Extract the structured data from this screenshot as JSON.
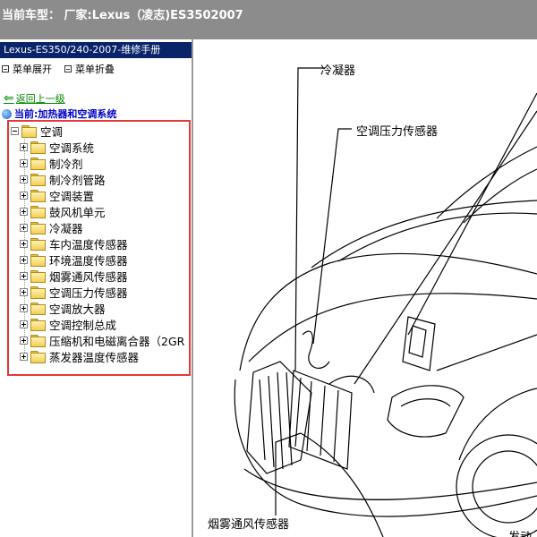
{
  "titlebar": {
    "text": "当前车型： 厂家:Lexus（凌志)ES3502007"
  },
  "sidebar": {
    "manual_title": "Lexus-ES350/240-2007-维修手册",
    "expand_label": "菜单展开",
    "collapse_label": "菜单折叠",
    "back_label": "返回上一级",
    "current_label": "当前:加热器和空调系统"
  },
  "tree": {
    "root": "空调",
    "items": [
      "空调系统",
      "制冷剂",
      "制冷剂管路",
      "空调装置",
      "鼓风机单元",
      "冷凝器",
      "车内温度传感器",
      "环境温度传感器",
      "烟雾通风传感器",
      "空调压力传感器",
      "空调放大器",
      "空调控制总成",
      "压缩机和电磁离合器（2GR",
      "蒸发器温度传感器"
    ]
  },
  "diagram": {
    "labels": {
      "condenser": "冷凝器",
      "pressure_sensor": "空调压力传感器",
      "smog_sensor": "烟雾通风传感器",
      "engine_partial": "发动"
    }
  },
  "colors": {
    "titlebar": "#8c8c8c",
    "manual_title_bg": "#0a246a",
    "highlight_border": "#e23a3a",
    "current_label": "#0000c8",
    "back_link": "#008800"
  }
}
